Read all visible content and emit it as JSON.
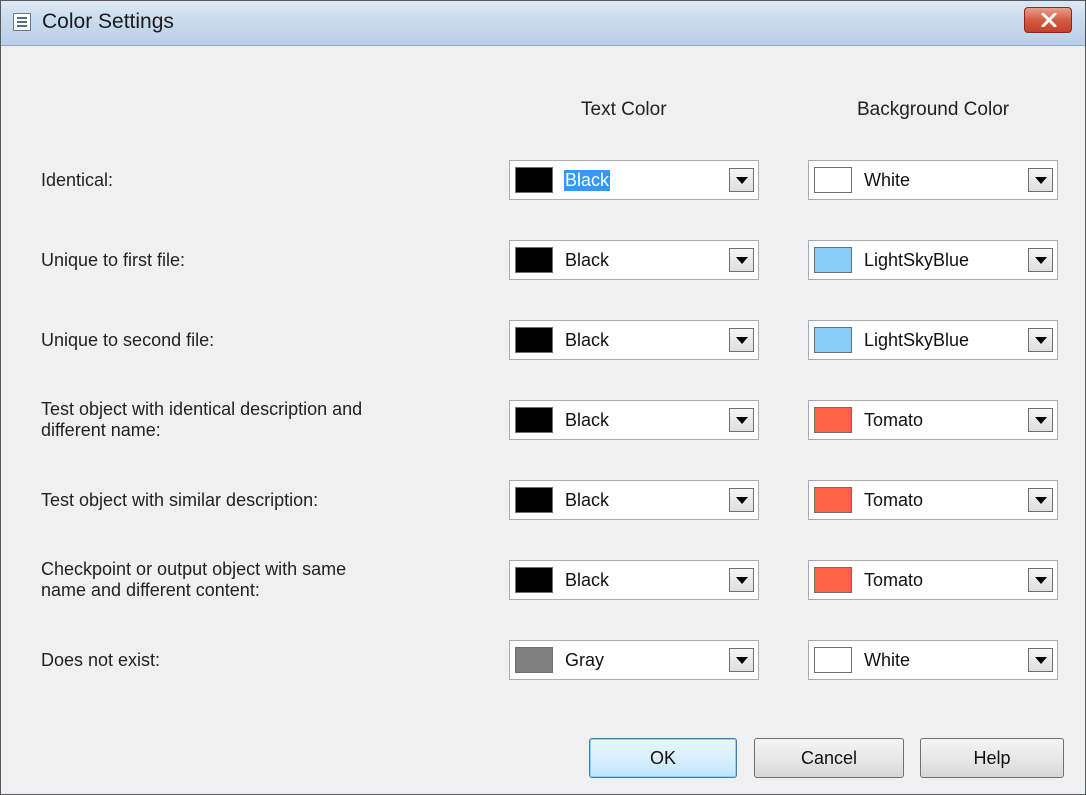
{
  "window": {
    "title": "Color Settings",
    "icon": "list-window-icon",
    "close_icon": "close-icon"
  },
  "columns": {
    "text_color": "Text Color",
    "background_color": "Background Color"
  },
  "rows": [
    {
      "label_lines": [
        "Identical:"
      ],
      "text": {
        "name": "Black",
        "color": "#000000",
        "selected": true
      },
      "bg": {
        "name": "White",
        "color": "#ffffff"
      }
    },
    {
      "label_lines": [
        "Unique to first file:"
      ],
      "text": {
        "name": "Black",
        "color": "#000000"
      },
      "bg": {
        "name": "LightSkyBlue",
        "color": "#87cefa"
      }
    },
    {
      "label_lines": [
        "Unique to second file:"
      ],
      "text": {
        "name": "Black",
        "color": "#000000"
      },
      "bg": {
        "name": "LightSkyBlue",
        "color": "#87cefa"
      }
    },
    {
      "label_lines": [
        "Test object with identical description and",
        "different name:"
      ],
      "text": {
        "name": "Black",
        "color": "#000000"
      },
      "bg": {
        "name": "Tomato",
        "color": "#ff6347"
      }
    },
    {
      "label_lines": [
        "Test object with similar description:"
      ],
      "text": {
        "name": "Black",
        "color": "#000000"
      },
      "bg": {
        "name": "Tomato",
        "color": "#ff6347"
      }
    },
    {
      "label_lines": [
        "Checkpoint or output object with same",
        "name and different content:"
      ],
      "text": {
        "name": "Black",
        "color": "#000000"
      },
      "bg": {
        "name": "Tomato",
        "color": "#ff6347"
      }
    },
    {
      "label_lines": [
        "Does not exist:"
      ],
      "text": {
        "name": "Gray",
        "color": "#808080"
      },
      "bg": {
        "name": "White",
        "color": "#ffffff"
      }
    }
  ],
  "buttons": {
    "ok": "OK",
    "cancel": "Cancel",
    "help": "Help"
  }
}
